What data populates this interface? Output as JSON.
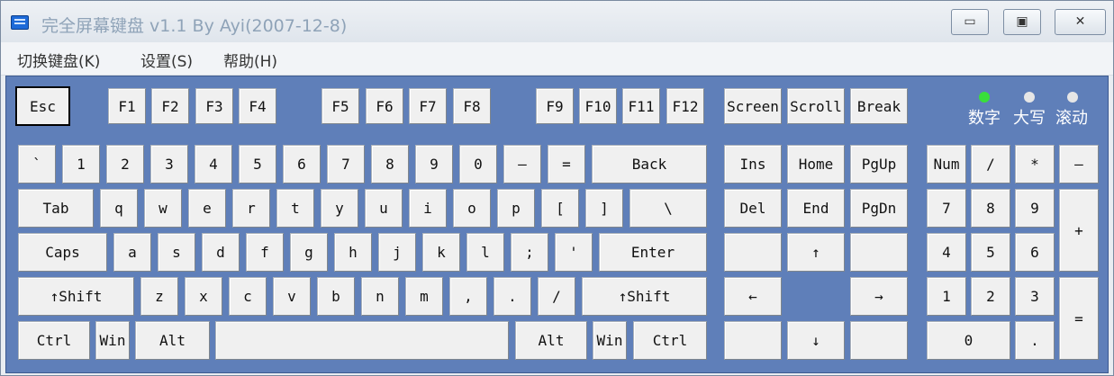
{
  "window": {
    "title": "完全屏幕键盘 v1.1 By Ayi(2007-12-8)",
    "minimize_glyph": "▭",
    "maximize_glyph": "▣",
    "close_glyph": "✕"
  },
  "menu": [
    "切换键盘(K)",
    "设置(S)",
    "帮助(H)"
  ],
  "indicators": [
    {
      "label": "数字",
      "color": "#39e03a"
    },
    {
      "label": "大写",
      "color": "#e6e6e6"
    },
    {
      "label": "滚动",
      "color": "#e6e6e6"
    }
  ],
  "keys": {
    "esc": "Esc",
    "f1": "F1",
    "f2": "F2",
    "f3": "F3",
    "f4": "F4",
    "f5": "F5",
    "f6": "F6",
    "f7": "F7",
    "f8": "F8",
    "f9": "F9",
    "f10": "F10",
    "f11": "F11",
    "f12": "F12",
    "screen": "Screen",
    "scroll": "Scroll",
    "break": "Break",
    "backtick": "`",
    "n1": "1",
    "n2": "2",
    "n3": "3",
    "n4": "4",
    "n5": "5",
    "n6": "6",
    "n7": "7",
    "n8": "8",
    "n9": "9",
    "n0": "0",
    "minus": "–",
    "equals": "=",
    "back": "Back",
    "tab": "Tab",
    "q": "q",
    "w": "w",
    "e": "e",
    "r": "r",
    "t": "t",
    "y": "y",
    "u": "u",
    "i": "i",
    "o": "o",
    "p": "p",
    "lbracket": "[",
    "rbracket": "]",
    "backslash": "\\",
    "caps": "Caps",
    "a": "a",
    "s": "s",
    "d": "d",
    "f": "f",
    "g": "g",
    "h": "h",
    "j": "j",
    "k": "k",
    "l": "l",
    "semicolon": ";",
    "quote": "'",
    "enter": "Enter",
    "lshift": "↑Shift",
    "z": "z",
    "x": "x",
    "c": "c",
    "v": "v",
    "b": "b",
    "n": "n",
    "m": "m",
    "comma": ",",
    "period": ".",
    "slash": "/",
    "rshift": "↑Shift",
    "lctrl": "Ctrl",
    "lwin": "Win",
    "lalt": "Alt",
    "space": "",
    "ralt": "Alt",
    "rwin": "Win",
    "rctrl": "Ctrl",
    "ins": "Ins",
    "home": "Home",
    "pgup": "PgUp",
    "del": "Del",
    "end": "End",
    "pgdn": "PgDn",
    "up": "↑",
    "left": "←",
    "right": "→",
    "down": "↓",
    "numlock": "Num",
    "numdiv": "/",
    "nummul": "*",
    "numsub": "–",
    "num7": "7",
    "num8": "8",
    "num9": "9",
    "numadd": "+",
    "num4": "4",
    "num5": "5",
    "num6": "6",
    "num1": "1",
    "num2": "2",
    "num3": "3",
    "numenter": "=",
    "num0": "0",
    "numdot": "."
  }
}
